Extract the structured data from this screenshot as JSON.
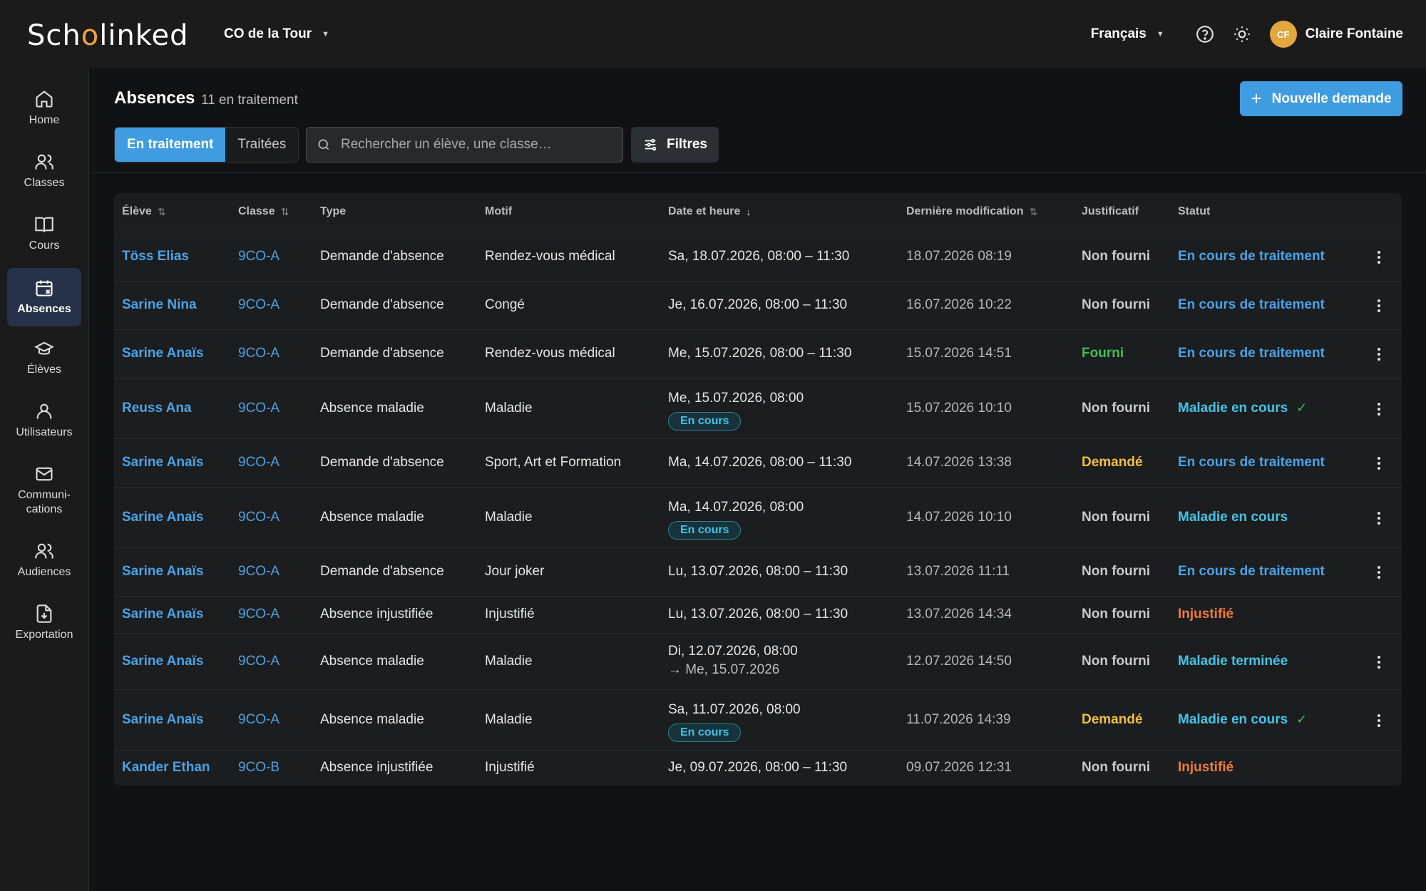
{
  "app": {
    "logo_prefix": "Sch",
    "logo_mark": "o",
    "logo_suffix": "linked",
    "school": "CO de la Tour",
    "language": "Français",
    "user_initials": "CF",
    "user_name": "Claire Fontaine"
  },
  "colors": {
    "accent": "#3f9ce0",
    "link": "#4aa3e6",
    "status_cyan": "#45c3e4",
    "provided_green": "#3fbf5a",
    "requested_yellow": "#f0c040",
    "unjustified_orange": "#f07a3a"
  },
  "sidebar": {
    "items": [
      {
        "label": "Home",
        "icon": "home-icon"
      },
      {
        "label": "Classes",
        "icon": "users-icon"
      },
      {
        "label": "Cours",
        "icon": "book-icon"
      },
      {
        "label": "Absences",
        "icon": "calendar-x-icon",
        "active": true
      },
      {
        "label": "Élèves",
        "icon": "graduation-cap-icon"
      },
      {
        "label": "Utilisateurs",
        "icon": "user-icon"
      },
      {
        "label": "Communi-cations",
        "icon": "mail-icon"
      },
      {
        "label": "Audiences",
        "icon": "users-icon"
      },
      {
        "label": "Exportation",
        "icon": "file-download-icon"
      }
    ]
  },
  "page": {
    "title": "Absences",
    "subtitle": "11 en traitement",
    "new_button": "Nouvelle demande",
    "tabs": [
      "En traitement",
      "Traitées"
    ],
    "search_placeholder": "Rechercher un élève, une classe…",
    "filters": "Filtres"
  },
  "table": {
    "columns": [
      "Élève",
      "Classe",
      "Type",
      "Motif",
      "Date et heure",
      "Dernière modification",
      "Justificatif",
      "Statut"
    ],
    "rows": [
      {
        "eleve": "Töss Elias",
        "classe": "9CO-A",
        "type": "Demande d'absence",
        "motif": "Rendez-vous médical",
        "date": "Sa, 18.07.2026, 08:00 – 11:30",
        "modif": "18.07.2026 08:19",
        "justificatif": "Non fourni",
        "statut": "En cours de traitement"
      },
      {
        "eleve": "Sarine Nina",
        "classe": "9CO-A",
        "type": "Demande d'absence",
        "motif": "Congé",
        "date": "Je, 16.07.2026, 08:00 – 11:30",
        "modif": "16.07.2026 10:22",
        "justificatif": "Non fourni",
        "statut": "En cours de traitement"
      },
      {
        "eleve": "Sarine Anaïs",
        "classe": "9CO-A",
        "type": "Demande d'absence",
        "motif": "Rendez-vous médical",
        "date": "Me, 15.07.2026, 08:00 – 11:30",
        "modif": "15.07.2026 14:51",
        "justificatif": "Fourni",
        "statut": "En cours de traitement"
      },
      {
        "eleve": "Reuss Ana",
        "classe": "9CO-A",
        "type": "Absence maladie",
        "motif": "Maladie",
        "date": "Me, 15.07.2026, 08:00",
        "badge": "En cours",
        "modif": "15.07.2026 10:10",
        "justificatif": "Non fourni",
        "statut": "Maladie en cours",
        "check": "✓"
      },
      {
        "eleve": "Sarine Anaïs",
        "classe": "9CO-A",
        "type": "Demande d'absence",
        "motif": "Sport, Art et Formation",
        "date": "Ma, 14.07.2026, 08:00 – 11:30",
        "modif": "14.07.2026 13:38",
        "justificatif": "Demandé",
        "statut": "En cours de traitement"
      },
      {
        "eleve": "Sarine Anaïs",
        "classe": "9CO-A",
        "type": "Absence maladie",
        "motif": "Maladie",
        "date": "Ma, 14.07.2026, 08:00",
        "badge": "En cours",
        "modif": "14.07.2026 10:10",
        "justificatif": "Non fourni",
        "statut": "Maladie en cours"
      },
      {
        "eleve": "Sarine Anaïs",
        "classe": "9CO-A",
        "type": "Demande d'absence",
        "motif": "Jour joker",
        "date": "Lu, 13.07.2026, 08:00 – 11:30",
        "modif": "13.07.2026 11:11",
        "justificatif": "Non fourni",
        "statut": "En cours de traitement"
      },
      {
        "eleve": "Sarine Anaïs",
        "classe": "9CO-A",
        "type": "Absence injustifiée",
        "motif": "Injustifié",
        "date": "Lu, 13.07.2026, 08:00 – 11:30",
        "modif": "13.07.2026 14:34",
        "justificatif": "Non fourni",
        "statut": "Injustifié"
      },
      {
        "eleve": "Sarine Anaïs",
        "classe": "9CO-A",
        "type": "Absence maladie",
        "motif": "Maladie",
        "date": "Di, 12.07.2026, 08:00",
        "date_end": "→ Me, 15.07.2026",
        "modif": "12.07.2026 14:50",
        "justificatif": "Non fourni",
        "statut": "Maladie terminée"
      },
      {
        "eleve": "Sarine Anaïs",
        "classe": "9CO-A",
        "type": "Absence maladie",
        "motif": "Maladie",
        "date": "Sa, 11.07.2026, 08:00",
        "badge": "En cours",
        "modif": "11.07.2026 14:39",
        "justificatif": "Demandé",
        "statut": "Maladie en cours",
        "check": "✓"
      },
      {
        "eleve": "Kander Ethan",
        "classe": "9CO-B",
        "type": "Absence injustifiée",
        "motif": "Injustifié",
        "date": "Je, 09.07.2026, 08:00 – 11:30",
        "modif": "09.07.2026 12:31",
        "justificatif": "Non fourni",
        "statut": "Injustifié"
      }
    ]
  }
}
